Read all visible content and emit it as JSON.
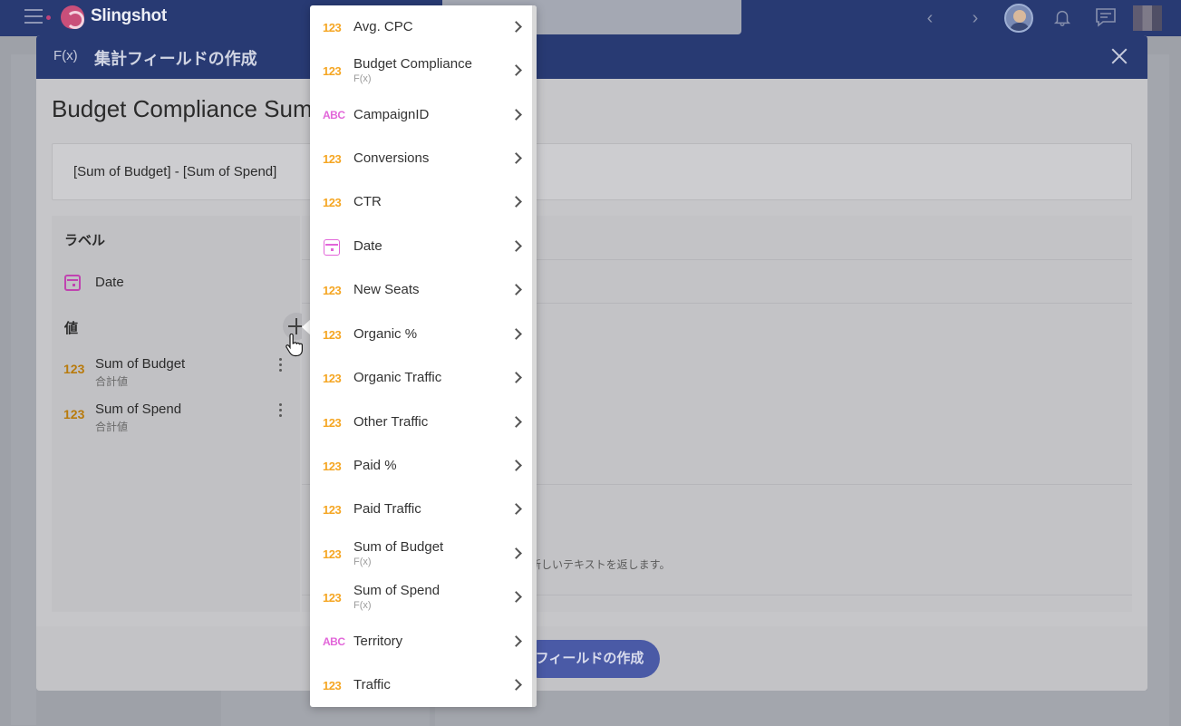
{
  "app": {
    "name": "Slingshot"
  },
  "modal": {
    "fx_label": "F(x)",
    "title": "集計フィールドの作成",
    "field_name": "Budget Compliance Sum",
    "formula": "[Sum of Budget] - [Sum of Spend]",
    "label_section": "ラベル",
    "label_items": [
      {
        "name": "Date",
        "icon": "calendar-icon"
      }
    ],
    "values_section": "値",
    "value_items": [
      {
        "type": "123",
        "name": "Sum of Budget",
        "sub": "合計値"
      },
      {
        "type": "123",
        "name": "Sum of Spend",
        "sub": "合計値"
      }
    ],
    "help_text": "…新しいテキストを返します。",
    "create_button": "フィールドの作成"
  },
  "dropdown": {
    "items": [
      {
        "type": "123",
        "label": "Avg. CPC",
        "sub": ""
      },
      {
        "type": "123",
        "label": "Budget Compliance",
        "sub": "F(x)"
      },
      {
        "type": "ABC",
        "label": "CampaignID",
        "sub": ""
      },
      {
        "type": "123",
        "label": "Conversions",
        "sub": ""
      },
      {
        "type": "123",
        "label": "CTR",
        "sub": ""
      },
      {
        "type": "date",
        "label": "Date",
        "sub": ""
      },
      {
        "type": "123",
        "label": "New Seats",
        "sub": ""
      },
      {
        "type": "123",
        "label": "Organic %",
        "sub": ""
      },
      {
        "type": "123",
        "label": "Organic Traffic",
        "sub": ""
      },
      {
        "type": "123",
        "label": "Other Traffic",
        "sub": ""
      },
      {
        "type": "123",
        "label": "Paid %",
        "sub": ""
      },
      {
        "type": "123",
        "label": "Paid Traffic",
        "sub": ""
      },
      {
        "type": "123",
        "label": "Sum of Budget",
        "sub": "F(x)"
      },
      {
        "type": "123",
        "label": "Sum of Spend",
        "sub": "F(x)"
      },
      {
        "type": "ABC",
        "label": "Territory",
        "sub": ""
      },
      {
        "type": "123",
        "label": "Traffic",
        "sub": ""
      }
    ]
  },
  "colors": {
    "header": "#283a73",
    "number_type": "#f5a623",
    "text_type": "#e266d9",
    "create_button": "#4a5aa6"
  }
}
